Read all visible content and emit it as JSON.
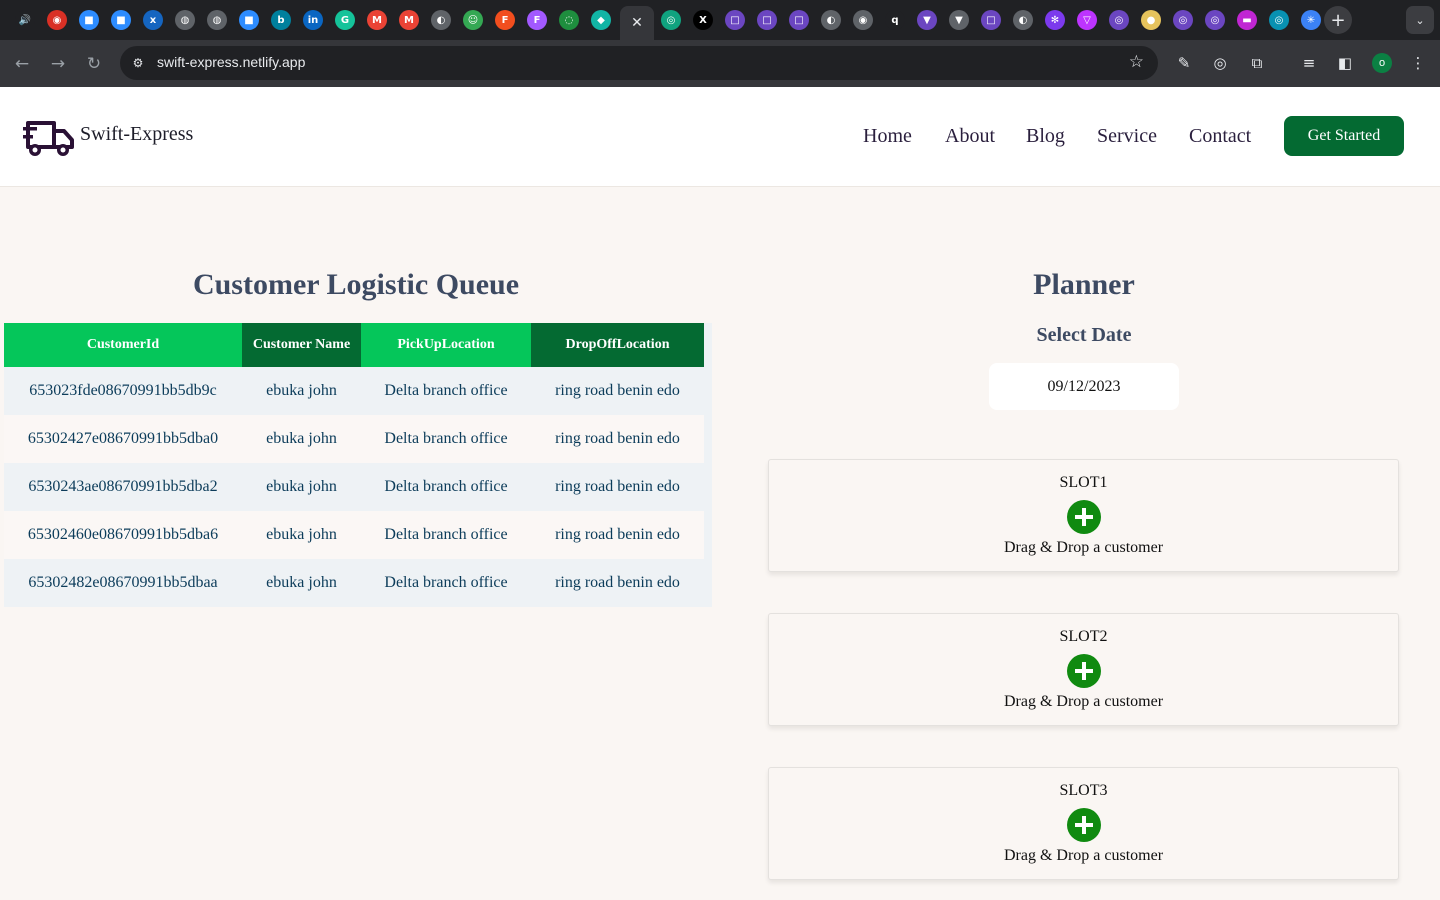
{
  "browser": {
    "url": "swift-express.netlify.app",
    "profile_initial": "o",
    "tabs": [
      {
        "icon": "speaker-icon",
        "glyph": "🔊",
        "color": "#202124"
      },
      {
        "icon": "chat-icon",
        "glyph": "◉",
        "color": "#d93025"
      },
      {
        "icon": "video-icon",
        "glyph": "■",
        "color": "#2d8cff"
      },
      {
        "icon": "video-icon",
        "glyph": "■",
        "color": "#2d8cff"
      },
      {
        "icon": "app-icon",
        "glyph": "x",
        "color": "#1565c0"
      },
      {
        "icon": "globe-icon",
        "glyph": "◍",
        "color": "#5f6368"
      },
      {
        "icon": "globe-icon",
        "glyph": "◍",
        "color": "#5f6368"
      },
      {
        "icon": "video-icon",
        "glyph": "■",
        "color": "#2d8cff"
      },
      {
        "icon": "bing-icon",
        "glyph": "b",
        "color": "#00809d"
      },
      {
        "icon": "linkedin-icon",
        "glyph": "in",
        "color": "#0a66c2"
      },
      {
        "icon": "grammarly-icon",
        "glyph": "G",
        "color": "#15c39a"
      },
      {
        "icon": "gmail-icon",
        "glyph": "M",
        "color": "#ea4335"
      },
      {
        "icon": "gmail-icon",
        "glyph": "M",
        "color": "#ea4335"
      },
      {
        "icon": "github-icon",
        "glyph": "◐",
        "color": "#5f6368"
      },
      {
        "icon": "robot-icon",
        "glyph": "☺",
        "color": "#34a853"
      },
      {
        "icon": "figma-icon",
        "glyph": "F",
        "color": "#f24e1e"
      },
      {
        "icon": "figma-icon",
        "glyph": "F",
        "color": "#a259ff"
      },
      {
        "icon": "spinner-icon",
        "glyph": "◌",
        "color": "#1e8e3e"
      },
      {
        "icon": "diamond-icon",
        "glyph": "◆",
        "color": "#12b5a5"
      }
    ],
    "tabs_right": [
      {
        "icon": "chatgpt-icon",
        "glyph": "◎",
        "color": "#10a37f"
      },
      {
        "icon": "x-icon",
        "glyph": "X",
        "color": "#000000"
      },
      {
        "icon": "app-icon",
        "glyph": "□",
        "color": "#6b46c1"
      },
      {
        "icon": "app-icon",
        "glyph": "□",
        "color": "#6b46c1"
      },
      {
        "icon": "app-icon",
        "glyph": "□",
        "color": "#6b46c1"
      },
      {
        "icon": "github-icon",
        "glyph": "◐",
        "color": "#5f6368"
      },
      {
        "icon": "chrome-icon",
        "glyph": "◉",
        "color": "#5f6368"
      },
      {
        "icon": "search-icon",
        "glyph": "q",
        "color": "#202124"
      },
      {
        "icon": "shield-icon",
        "glyph": "▼",
        "color": "#6b46c1"
      },
      {
        "icon": "shield-icon",
        "glyph": "▼",
        "color": "#5f6368"
      },
      {
        "icon": "app-icon",
        "glyph": "□",
        "color": "#6b46c1"
      },
      {
        "icon": "github-icon",
        "glyph": "◐",
        "color": "#5f6368"
      },
      {
        "icon": "gear-icon",
        "glyph": "✻",
        "color": "#7c3aed"
      },
      {
        "icon": "vite-icon",
        "glyph": "▽",
        "color": "#bd34fe"
      },
      {
        "icon": "app-icon",
        "glyph": "◎",
        "color": "#6b46c1"
      },
      {
        "icon": "circle-icon",
        "glyph": "●",
        "color": "#e6c35c"
      },
      {
        "icon": "app-icon",
        "glyph": "◎",
        "color": "#6b46c1"
      },
      {
        "icon": "app-icon",
        "glyph": "◎",
        "color": "#6b46c1"
      },
      {
        "icon": "folder-icon",
        "glyph": "▬",
        "color": "#c026d3"
      },
      {
        "icon": "app-icon",
        "glyph": "◎",
        "color": "#0891b2"
      },
      {
        "icon": "react-icon",
        "glyph": "✳",
        "color": "#3b82f6"
      }
    ]
  },
  "header": {
    "brand": "Swift-Express",
    "nav": [
      "Home",
      "About",
      "Blog",
      "Service",
      "Contact"
    ],
    "cta": "Get Started"
  },
  "queue": {
    "title": "Customer Logistic Queue",
    "columns": [
      "CustomerId",
      "Customer Name",
      "PickUpLocation",
      "DropOffLocation"
    ],
    "rows": [
      [
        "653023fde08670991bb5db9c",
        "ebuka john",
        "Delta branch office",
        "ring road benin edo"
      ],
      [
        "65302427e08670991bb5dba0",
        "ebuka john",
        "Delta branch office",
        "ring road benin edo"
      ],
      [
        "6530243ae08670991bb5dba2",
        "ebuka john",
        "Delta branch office",
        "ring road benin edo"
      ],
      [
        "65302460e08670991bb5dba6",
        "ebuka john",
        "Delta branch office",
        "ring road benin edo"
      ],
      [
        "65302482e08670991bb5dbaa",
        "ebuka john",
        "Delta branch office",
        "ring road benin edo"
      ]
    ]
  },
  "planner": {
    "title": "Planner",
    "date_label": "Select Date",
    "date_value": "09/12/2023",
    "slots": [
      {
        "name": "SLOT1",
        "hint": "Drag & Drop a customer"
      },
      {
        "name": "SLOT2",
        "hint": "Drag & Drop a customer"
      },
      {
        "name": "SLOT3",
        "hint": "Drag & Drop a customer"
      }
    ]
  },
  "colors": {
    "header_green_light": "#05c65a",
    "header_green_dark": "#046a32",
    "add_icon": "#108a10",
    "title": "#3d4a62"
  }
}
